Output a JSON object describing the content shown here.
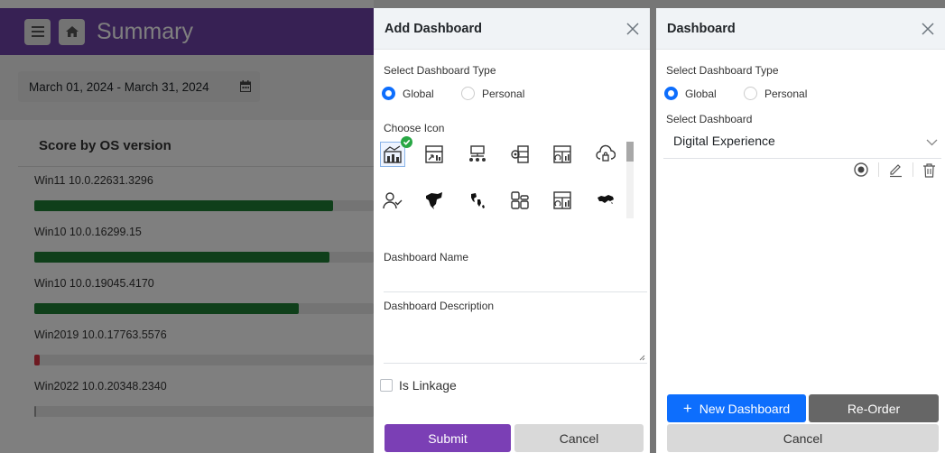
{
  "app": {
    "title": "Summary",
    "date_range": "March 01, 2024 - March 31, 2024",
    "score_title": "Score by OS version",
    "os_rows": [
      {
        "label": "Win11 10.0.22631.3296",
        "score_pct": 88,
        "color": "#1e7e34"
      },
      {
        "label": "Win10 10.0.16299.15",
        "score_pct": 87,
        "color": "#1e7e34"
      },
      {
        "label": "Win10 10.0.19045.4170",
        "score_pct": 78,
        "color": "#1e7e34"
      },
      {
        "label": "Win2019 10.0.17763.5576",
        "score_pct": 1,
        "color": "#dc3545"
      },
      {
        "label": "Win2022 10.0.20348.2340",
        "score_pct": 0,
        "color": "#9e9e9e"
      }
    ]
  },
  "add_dashboard": {
    "title": "Add Dashboard",
    "type_label": "Select Dashboard Type",
    "type_options": [
      {
        "label": "Global",
        "selected": true
      },
      {
        "label": "Personal",
        "selected": false
      }
    ],
    "icon_label": "Choose Icon",
    "icons": [
      "dashboard-chart-icon",
      "report-icon",
      "hierarchy-icon",
      "settings-layout-icon",
      "grid-chart-icon",
      "cloud-lock-icon",
      "user-check-icon",
      "north-america-map-icon",
      "world-map-icon",
      "widgets-icon",
      "grid-chart-alt-icon",
      "africa-map-icon"
    ],
    "name_label": "Dashboard Name",
    "description_label": "Dashboard Description",
    "linkage_label": "Is Linkage",
    "submit_label": "Submit",
    "cancel_label": "Cancel",
    "accent": "#7b3fb5"
  },
  "dashboard": {
    "title": "Dashboard",
    "type_label": "Select Dashboard Type",
    "type_options": [
      {
        "label": "Global",
        "selected": true
      },
      {
        "label": "Personal",
        "selected": false
      }
    ],
    "select_label": "Select Dashboard",
    "selected_value": "Digital Experience",
    "new_label": "New Dashboard",
    "reorder_label": "Re-Order",
    "cancel_label": "Cancel",
    "primary_color": "#0d6efd",
    "secondary_color": "#666666"
  }
}
